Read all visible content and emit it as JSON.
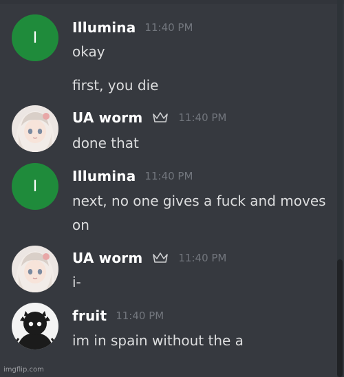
{
  "colors": {
    "background": "#36393f",
    "username": "#ffffff",
    "timestamp": "#72767d",
    "message_text": "#dcddde",
    "illumina_avatar": "#1f8b3b"
  },
  "messages": [
    {
      "author": "Illumina",
      "avatar_letter": "I",
      "time": "11:40 PM",
      "lines": [
        "okay",
        "first, you die"
      ]
    },
    {
      "author": "UA worm",
      "owner_icon": "crown-icon",
      "time": "11:40 PM",
      "lines": [
        "done that"
      ]
    },
    {
      "author": "Illumina",
      "avatar_letter": "I",
      "time": "11:40 PM",
      "lines": [
        "next, no one gives a fuck and moves",
        "on"
      ]
    },
    {
      "author": "UA worm",
      "owner_icon": "crown-icon",
      "time": "11:40 PM",
      "lines": [
        "i-"
      ]
    },
    {
      "author": "fruit",
      "time": "11:40 PM",
      "lines": [
        "im in spain without the a"
      ]
    }
  ],
  "watermark": "imgflip.com"
}
